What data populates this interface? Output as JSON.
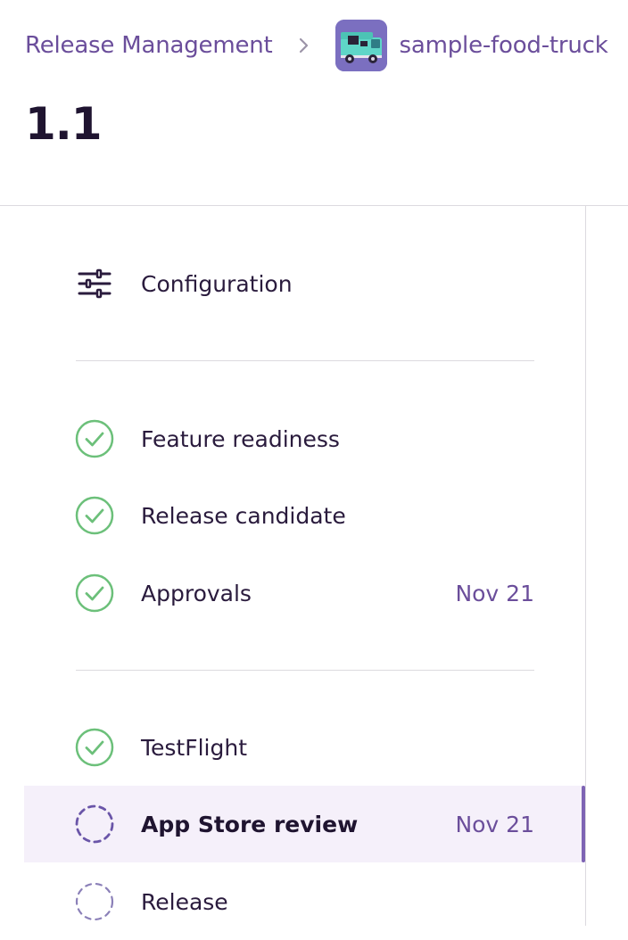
{
  "breadcrumb": {
    "parent_label": "Release Management",
    "app_name": "sample-food-truck",
    "separator_icon": "chevron-right-icon",
    "app_icon": "food-truck-icon"
  },
  "page": {
    "title": "1.1"
  },
  "nav": {
    "configuration": {
      "label": "Configuration",
      "icon": "sliders-icon"
    },
    "items": [
      {
        "label": "Feature readiness",
        "status": "complete",
        "date": ""
      },
      {
        "label": "Release candidate",
        "status": "complete",
        "date": ""
      },
      {
        "label": "Approvals",
        "status": "complete",
        "date": "Nov 21"
      },
      {
        "label": "TestFlight",
        "status": "complete",
        "date": ""
      },
      {
        "label": "App Store review",
        "status": "pending",
        "date": "Nov 21",
        "active": true
      },
      {
        "label": "Release",
        "status": "pending",
        "date": ""
      }
    ]
  },
  "colors": {
    "accent": "#6b4e9b",
    "complete": "#6cc07a",
    "pending": "#7a68b0",
    "active_bg": "#f5f0fa"
  }
}
